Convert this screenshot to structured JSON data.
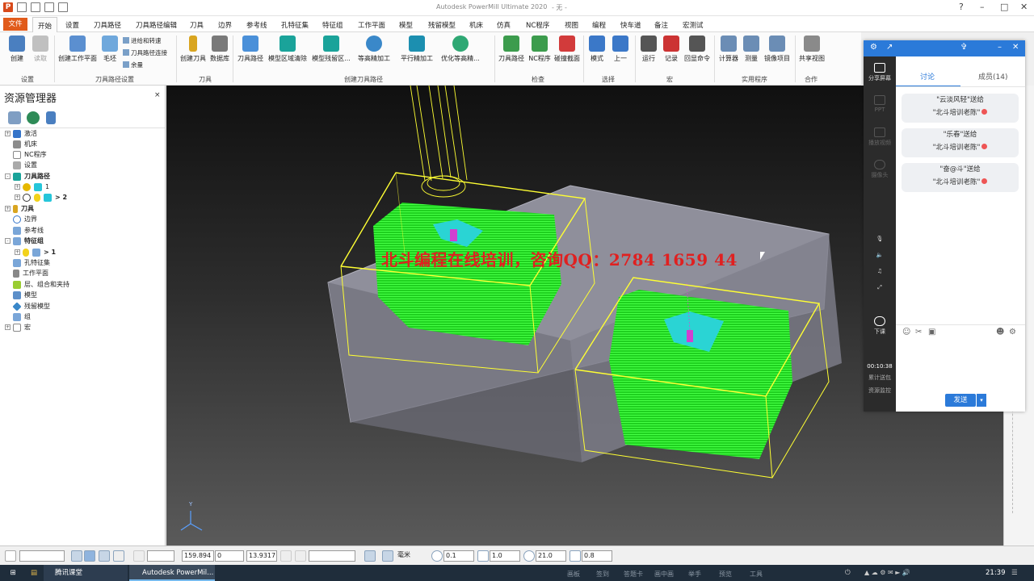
{
  "window": {
    "app_title": "Autodesk PowerMill Ultimate 2020",
    "doc_title": "- 无 -",
    "help_icon": "help-icon"
  },
  "menu": {
    "file": "文件",
    "items": [
      "开始",
      "设置",
      "刀具路径",
      "刀具路径编辑",
      "刀具",
      "边界",
      "参考线",
      "孔特征集",
      "特征组",
      "工作平面",
      "模型",
      "残留模型",
      "机床",
      "仿真",
      "NC程序",
      "视图",
      "编程",
      "快车道",
      "备注",
      "宏测试"
    ]
  },
  "ribbon": {
    "buttons": {
      "create": "创建",
      "import": "读取",
      "create_workplane": "创建工作平面",
      "stock": "毛坯",
      "feed_speed": "进给和转速",
      "toolpath_connect": "刀具路径连接",
      "allowance": "余量",
      "create_tool": "创建刀具",
      "database": "数据库",
      "toolpath": "刀具路径",
      "area_clear": "模型区域清除",
      "rest_area": "模型残留区...",
      "constant_z": "等高精加工",
      "raster": "平行精加工",
      "opt_constant_z": "优化等高精...",
      "check_toolpath": "刀具路径",
      "check_nc": "NC程序",
      "collision": "碰撞截面",
      "mode": "模式",
      "previous": "上一",
      "run": "运行",
      "record": "记录",
      "echo": "回显命令",
      "calculator": "计算器",
      "measure": "测量",
      "mirror": "镜像项目",
      "share_view": "共享视图"
    },
    "groups": {
      "setup": "设置",
      "toolpath_setup": "刀具路径设置",
      "tool": "刀具",
      "create_toolpath": "创建刀具路径",
      "check": "检查",
      "select": "选择",
      "macro": "宏",
      "utilities": "实用程序",
      "collaborate": "合作"
    }
  },
  "explorer": {
    "title": "资源管理器",
    "close": "×",
    "tree": [
      {
        "label": "激活",
        "bold": false
      },
      {
        "label": "机床",
        "bold": false
      },
      {
        "label": "NC程序",
        "bold": false
      },
      {
        "label": "设置",
        "bold": false
      },
      {
        "label": "刀具路径",
        "bold": true
      },
      {
        "label": "1",
        "bold": false
      },
      {
        "label": "> 2",
        "bold": true
      },
      {
        "label": "刀具",
        "bold": true
      },
      {
        "label": "边界",
        "bold": false
      },
      {
        "label": "参考线",
        "bold": false
      },
      {
        "label": "特征组",
        "bold": true
      },
      {
        "label": "> 1",
        "bold": true
      },
      {
        "label": "孔特征集",
        "bold": false
      },
      {
        "label": "工作平面",
        "bold": false
      },
      {
        "label": "层、组合和夹持",
        "bold": false
      },
      {
        "label": "模型",
        "bold": false
      },
      {
        "label": "残留模型",
        "bold": false
      },
      {
        "label": "组",
        "bold": false
      },
      {
        "label": "宏",
        "bold": false
      }
    ]
  },
  "viewport": {
    "watermark": "北斗编程在线培训，咨询QQ：2784 1659 44",
    "axis_label": "Y",
    "colors": {
      "stock": "#8f8f9b",
      "block": "#ffff33",
      "pattern": "#22ee22"
    }
  },
  "status": {
    "x": "159.894",
    "y": "0",
    "z": "13.9317",
    "unit": "毫米",
    "tolerance": "0.1",
    "thickness": "1.0",
    "diameter": "21.0",
    "step": "0.8"
  },
  "chat": {
    "tabs": {
      "discuss": "讨论",
      "members": "成员(14)"
    },
    "side": {
      "share_screen": "分享屏幕",
      "ppt": "PPT",
      "play_video": "播放视频",
      "camera": "摄像头",
      "end_class": "下课",
      "timer": "00:10:38",
      "gifts": "累计送包",
      "resources": "资源监控"
    },
    "messages": [
      {
        "from": "\"云淡风轻\"送给",
        "to": "\"北斗培训老陈\""
      },
      {
        "from": "\"乐春\"送给",
        "to": "\"北斗培训老陈\""
      },
      {
        "from": "\"奋@斗\"送给",
        "to": "\"北斗培训老陈\""
      }
    ],
    "send": "发送"
  },
  "taskbar": {
    "apps": [
      "腾讯课堂",
      "Autodesk PowerMil..."
    ],
    "ghost": [
      "画板",
      "签到",
      "答题卡",
      "画中画",
      "举手",
      "预览",
      "工具"
    ],
    "time": "21:39"
  }
}
